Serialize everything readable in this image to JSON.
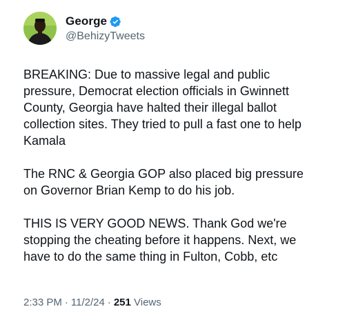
{
  "author": {
    "display_name": "George",
    "handle": "@BehizyTweets",
    "avatar_icon": "user-avatar-icon",
    "verified_icon": "verified-badge-icon",
    "verified_color": "#1d9bf0"
  },
  "tweet": {
    "paragraphs": [
      "BREAKING: Due to massive legal and public\npressure, Democrat election officials in Gwinnett\nCounty, Georgia have halted their illegal ballot\ncollection sites. They tried to pull a fast one to help\nKamala",
      "The RNC & Georgia GOP also placed big pressure\non Governor Brian Kemp to do his job.",
      "THIS IS VERY GOOD NEWS. Thank God we're\nstopping the cheating before it happens. Next, we\nhave to do the same thing in Fulton, Cobb, etc"
    ]
  },
  "meta": {
    "time": "2:33 PM",
    "separator": "·",
    "date": "11/2/24",
    "views_count": "251",
    "views_label": "Views"
  }
}
